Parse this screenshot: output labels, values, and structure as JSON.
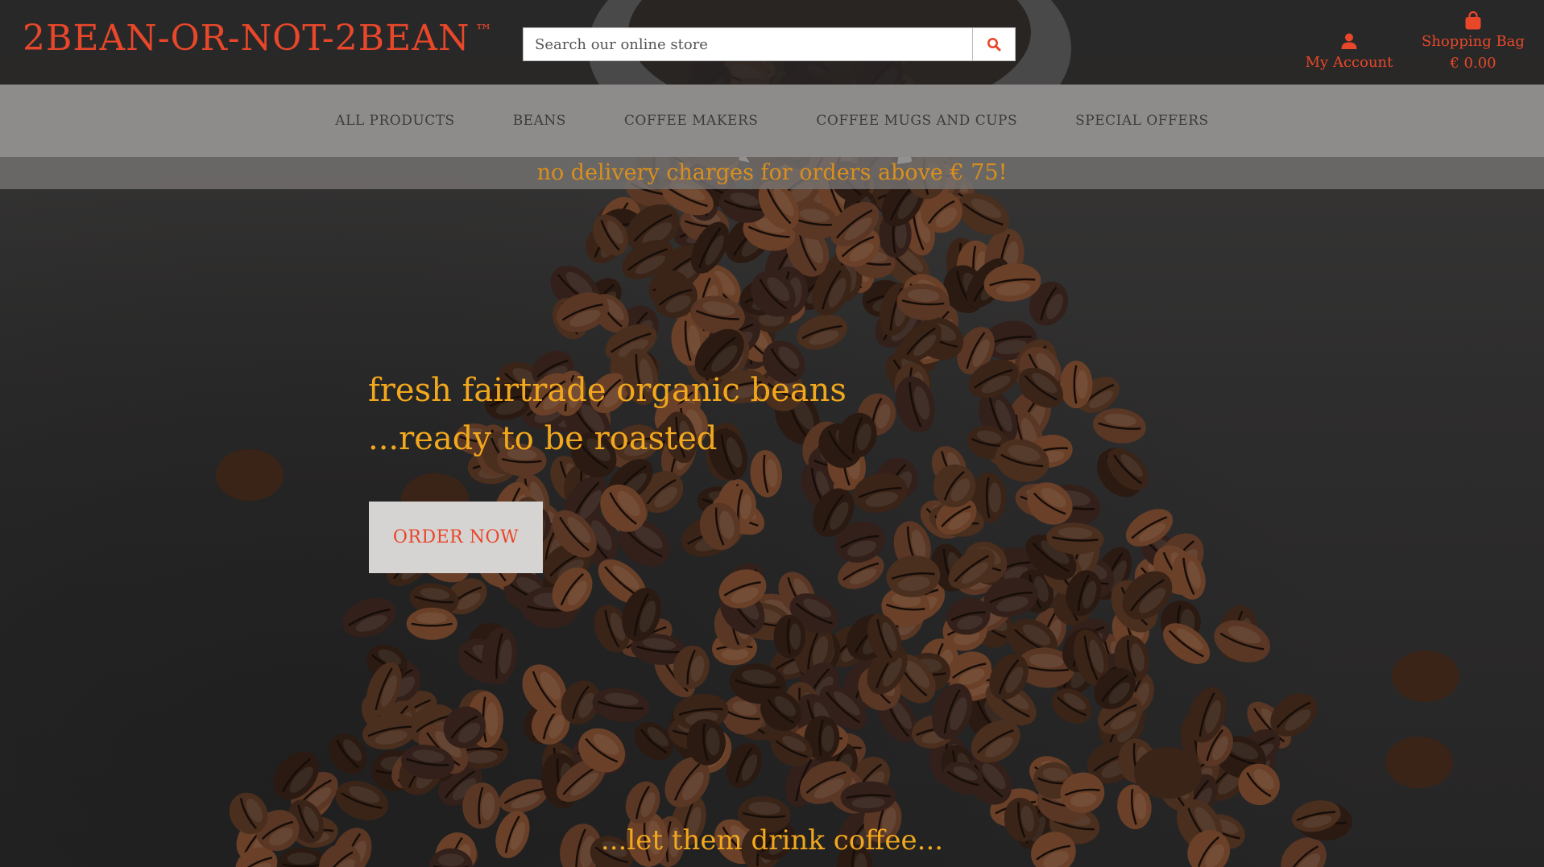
{
  "header": {
    "logo_text": "2BEAN-OR-NOT-2BEAN",
    "logo_trademark": "™",
    "search": {
      "placeholder": "Search our online store",
      "value": ""
    },
    "account_label": "My Account",
    "bag_label": "Shopping Bag",
    "bag_total": "€ 0.00"
  },
  "nav": {
    "items": [
      {
        "label": "ALL PRODUCTS"
      },
      {
        "label": "BEANS"
      },
      {
        "label": "COFFEE MAKERS"
      },
      {
        "label": "COFFEE MUGS AND CUPS"
      },
      {
        "label": "SPECIAL OFFERS"
      }
    ]
  },
  "promo": {
    "text": "no delivery charges for orders above € 75!"
  },
  "hero": {
    "line1": "fresh fairtrade organic beans",
    "line2": "...ready to be roasted",
    "cta_label": "ORDER NOW",
    "tagline": "...let them drink coffee..."
  },
  "colors": {
    "brand_accent": "#e8472a",
    "hero_text": "#f2a81d",
    "promo_text": "#d98f1c",
    "nav_bg": "#8e8c8b",
    "button_bg": "#d6d4d3"
  },
  "icons": {
    "search": "search-icon",
    "account": "user-icon",
    "bag": "shopping-bag-icon"
  }
}
